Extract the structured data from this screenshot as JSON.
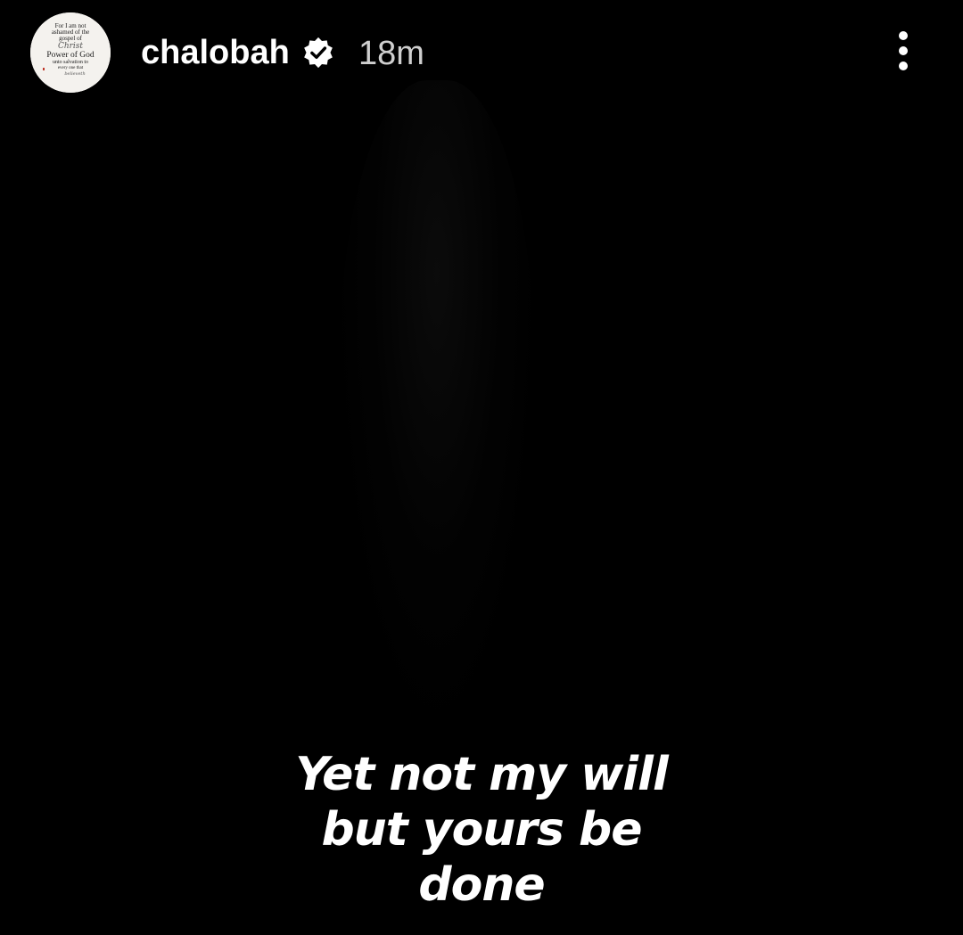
{
  "story": {
    "username": "chalobah",
    "verified": true,
    "timestamp": "18m",
    "caption_lines": [
      "Yet not my will",
      "but yours be",
      "done"
    ]
  },
  "avatar": {
    "lines": [
      "For I am not",
      "ashamed of the",
      "gospel of",
      "Christ",
      "Power of God",
      "unto salvation to",
      "every one that",
      "believeth"
    ],
    "background": "#f4f2ee",
    "text_color": "#1a1a1a"
  },
  "icons": {
    "verified": "verified-badge-icon",
    "more": "more-vertical-icon"
  },
  "colors": {
    "background": "#000000",
    "text": "#ffffff",
    "timestamp": "#cfcfcf",
    "verified_badge": "#ffffff"
  }
}
